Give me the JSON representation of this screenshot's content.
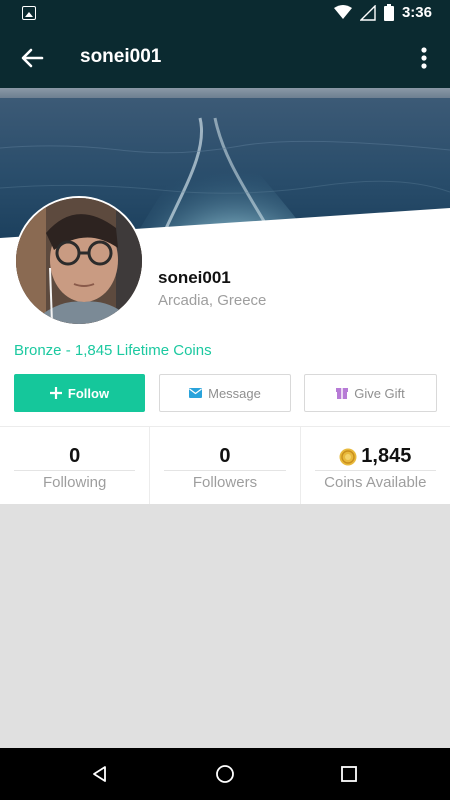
{
  "status_bar": {
    "time": "3:36"
  },
  "app_bar": {
    "title": "sonei001"
  },
  "profile": {
    "name": "sonei001",
    "location": "Arcadia, Greece",
    "tier": "Bronze - 1,845 Lifetime Coins"
  },
  "actions": {
    "follow_label": "Follow",
    "message_label": "Message",
    "gift_label": "Give Gift"
  },
  "stats": [
    {
      "value": "0",
      "label": "Following"
    },
    {
      "value": "0",
      "label": "Followers"
    },
    {
      "value": "1,845",
      "label": "Coins Available",
      "icon": "coin-icon"
    }
  ],
  "colors": {
    "top_bar": "#0b2a30",
    "accent": "#15c79b",
    "tier_text": "#1cc9a0",
    "gift_icon": "#b77bd6",
    "message_icon": "#2aa3db",
    "coin": "#e8b93c"
  },
  "icons": {
    "status_left": "image-notification-icon",
    "status_right": [
      "wifi-icon",
      "signal-icon",
      "battery-icon"
    ],
    "back": "arrow-back-icon",
    "menu": "more-vert-icon",
    "nav": [
      "nav-back-icon",
      "nav-home-icon",
      "nav-recents-icon"
    ]
  }
}
